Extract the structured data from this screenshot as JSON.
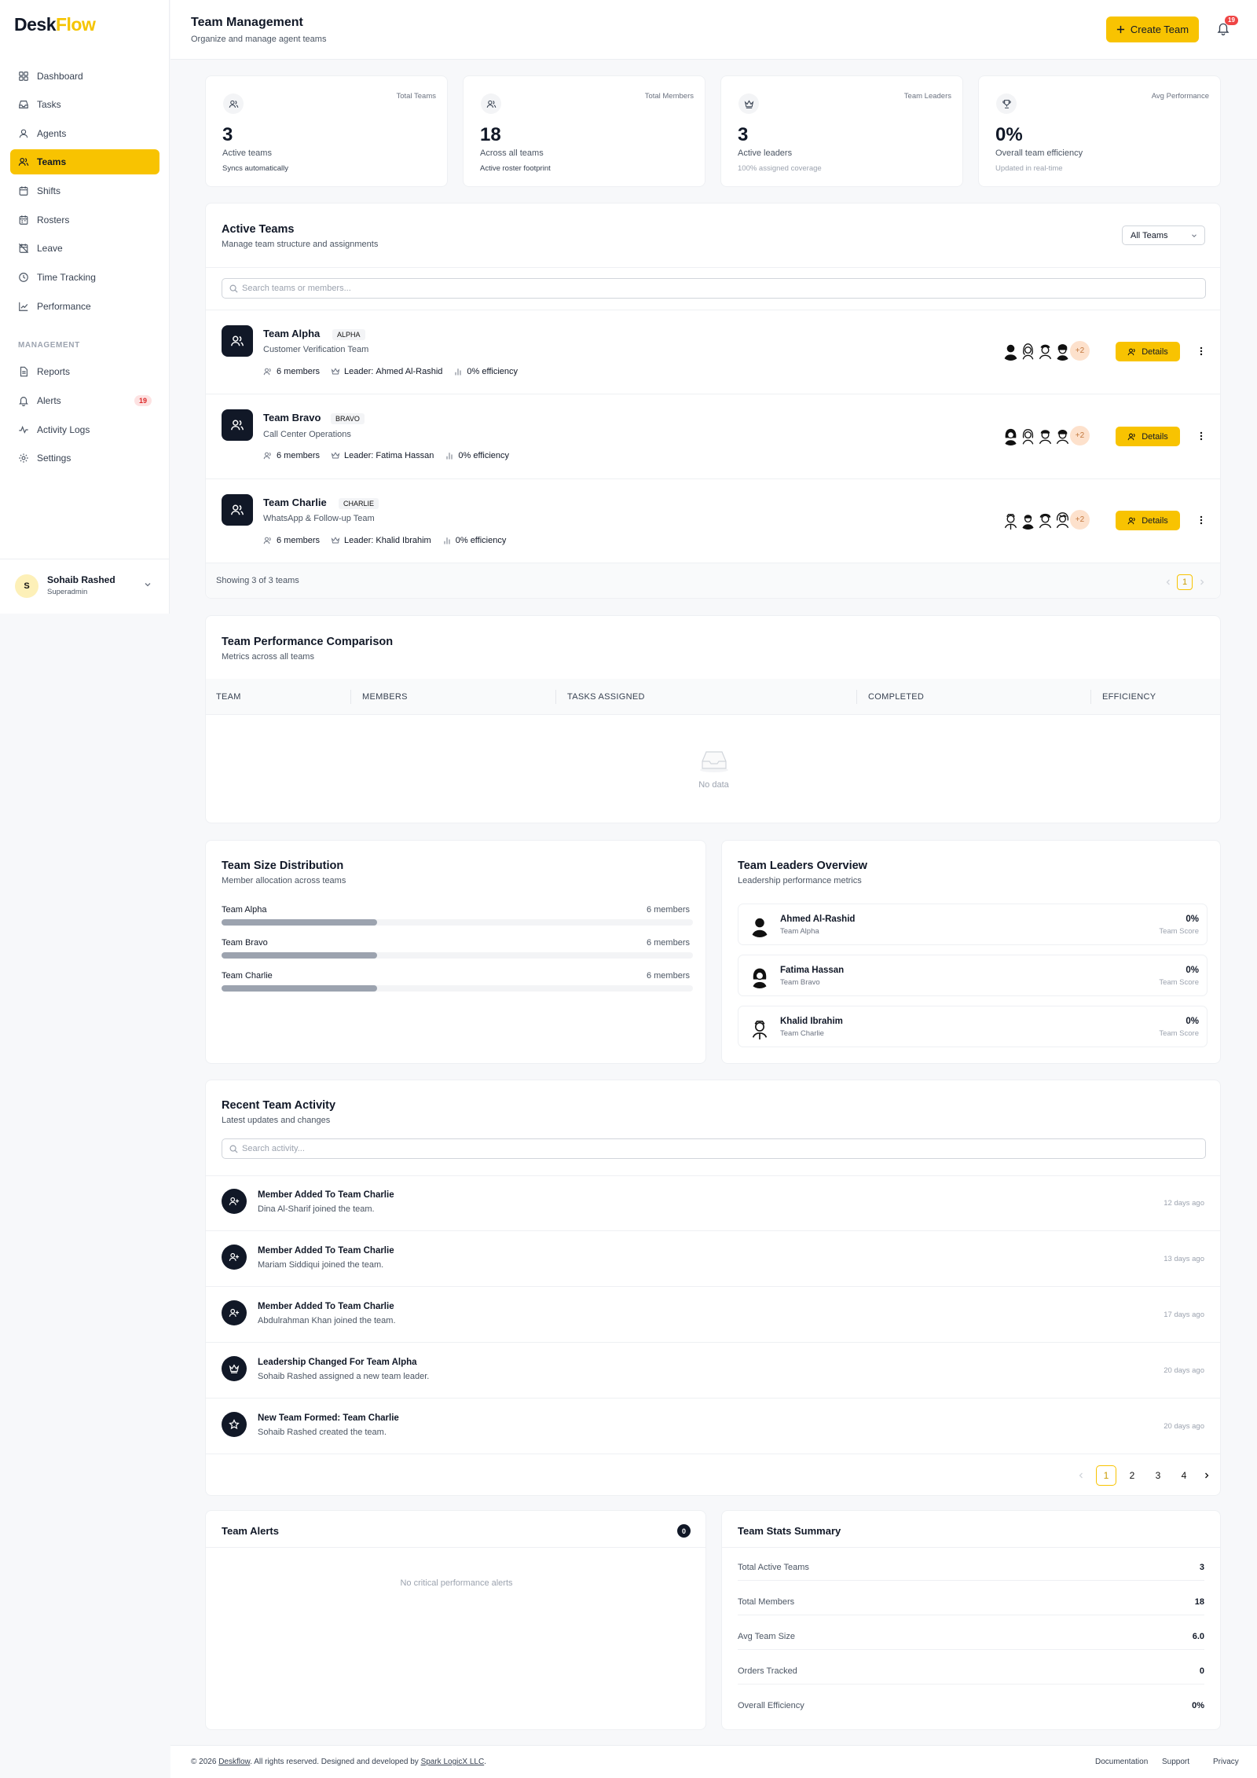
{
  "brand": {
    "part1": "Desk",
    "part2": "Flow"
  },
  "sidebar": {
    "items": [
      {
        "label": "Dashboard",
        "icon": "grid-icon"
      },
      {
        "label": "Tasks",
        "icon": "inbox-icon"
      },
      {
        "label": "Agents",
        "icon": "user-icon"
      },
      {
        "label": "Teams",
        "icon": "users-icon",
        "active": true
      },
      {
        "label": "Shifts",
        "icon": "calendar-icon"
      },
      {
        "label": "Rosters",
        "icon": "calendar-icon"
      },
      {
        "label": "Leave",
        "icon": "calendar-off-icon"
      },
      {
        "label": "Time Tracking",
        "icon": "clock-icon"
      },
      {
        "label": "Performance",
        "icon": "line-chart-icon"
      }
    ],
    "section_label": "MANAGEMENT",
    "mgmt_items": [
      {
        "label": "Reports",
        "icon": "file-icon"
      },
      {
        "label": "Alerts",
        "icon": "bell-icon",
        "badge": "19"
      },
      {
        "label": "Activity Logs",
        "icon": "activity-icon"
      },
      {
        "label": "Settings",
        "icon": "gear-icon"
      }
    ],
    "user": {
      "initial": "S",
      "name": "Sohaib Rashed",
      "role": "Superadmin"
    }
  },
  "header": {
    "title": "Team Management",
    "subtitle": "Organize and manage agent teams",
    "create_label": "Create Team",
    "notif_count": "19"
  },
  "stats": [
    {
      "label": "Total Teams",
      "value": "3",
      "sub": "Active teams",
      "note": "Syncs automatically",
      "icon": "users-icon"
    },
    {
      "label": "Total Members",
      "value": "18",
      "sub": "Across all teams",
      "note": "Active roster footprint",
      "icon": "users-icon"
    },
    {
      "label": "Team Leaders",
      "value": "3",
      "sub": "Active leaders",
      "note": "100% assigned coverage",
      "icon": "crown-icon"
    },
    {
      "label": "Avg Performance",
      "value": "0%",
      "sub": "Overall team efficiency",
      "note": "Updated in real-time",
      "icon": "trophy-icon"
    }
  ],
  "active_teams": {
    "title": "Active Teams",
    "subtitle": "Manage team structure and assignments",
    "filter": "All Teams",
    "search_placeholder": "Search teams or members...",
    "details_label": "Details",
    "more_label": "+2",
    "leader_prefix": "Leader:",
    "teams": [
      {
        "name": "Team Alpha",
        "code": "ALPHA",
        "desc": "Customer Verification Team",
        "members": "6 members",
        "leader": "Ahmed Al-Rashid",
        "efficiency": "0% efficiency"
      },
      {
        "name": "Team Bravo",
        "code": "BRAVO",
        "desc": "Call Center Operations",
        "members": "6 members",
        "leader": "Fatima Hassan",
        "efficiency": "0% efficiency"
      },
      {
        "name": "Team Charlie",
        "code": "CHARLIE",
        "desc": "WhatsApp & Follow-up Team",
        "members": "6 members",
        "leader": "Khalid Ibrahim",
        "efficiency": "0% efficiency"
      }
    ],
    "showing": "Showing 3 of 3 teams",
    "page": "1"
  },
  "comparison": {
    "title": "Team Performance Comparison",
    "subtitle": "Metrics across all teams",
    "columns": [
      "TEAM",
      "MEMBERS",
      "TASKS ASSIGNED",
      "COMPLETED",
      "EFFICIENCY"
    ],
    "empty": "No data"
  },
  "size_dist": {
    "title": "Team Size Distribution",
    "subtitle": "Member allocation across teams",
    "rows": [
      {
        "team": "Team Alpha",
        "value": "6 members",
        "share": 0.33
      },
      {
        "team": "Team Bravo",
        "value": "6 members",
        "share": 0.33
      },
      {
        "team": "Team Charlie",
        "value": "6 members",
        "share": 0.33
      }
    ]
  },
  "leaders": {
    "title": "Team Leaders Overview",
    "subtitle": "Leadership performance metrics",
    "score_label": "Team Score",
    "rows": [
      {
        "name": "Ahmed Al-Rashid",
        "team": "Team Alpha",
        "score": "0%"
      },
      {
        "name": "Fatima Hassan",
        "team": "Team Bravo",
        "score": "0%"
      },
      {
        "name": "Khalid Ibrahim",
        "team": "Team Charlie",
        "score": "0%"
      }
    ]
  },
  "activity": {
    "title": "Recent Team Activity",
    "subtitle": "Latest updates and changes",
    "search_placeholder": "Search activity...",
    "items": [
      {
        "title": "Member Added To Team Charlie",
        "desc": "Dina Al-Sharif joined the team.",
        "time": "12 days ago",
        "icon": "user-plus-icon"
      },
      {
        "title": "Member Added To Team Charlie",
        "desc": "Mariam Siddiqui joined the team.",
        "time": "13 days ago",
        "icon": "user-plus-icon"
      },
      {
        "title": "Member Added To Team Charlie",
        "desc": "Abdulrahman Khan joined the team.",
        "time": "17 days ago",
        "icon": "user-plus-icon"
      },
      {
        "title": "Leadership Changed For Team Alpha",
        "desc": "Sohaib Rashed assigned a new team leader.",
        "time": "20 days ago",
        "icon": "crown-icon"
      },
      {
        "title": "New Team Formed: Team Charlie",
        "desc": "Sohaib Rashed created the team.",
        "time": "20 days ago",
        "icon": "star-icon"
      }
    ],
    "pages": [
      "1",
      "2",
      "3",
      "4"
    ]
  },
  "alerts": {
    "title": "Team Alerts",
    "count": "0",
    "empty": "No critical performance alerts"
  },
  "summary": {
    "title": "Team Stats Summary",
    "rows": [
      {
        "label": "Total Active Teams",
        "value": "3"
      },
      {
        "label": "Total Members",
        "value": "18"
      },
      {
        "label": "Avg Team Size",
        "value": "6.0"
      },
      {
        "label": "Orders Tracked",
        "value": "0"
      },
      {
        "label": "Overall Efficiency",
        "value": "0%"
      }
    ]
  },
  "footer": {
    "copy_prefix": "© 2026",
    "brand": "Deskflow",
    "copy_mid": ". All rights reserved. Designed and developed by",
    "dev": "Spark LogicX LLC",
    "copy_end": ".",
    "links": [
      "Documentation",
      "Support",
      "Privacy"
    ]
  },
  "colors": {
    "accent": "#f8c301",
    "dark": "#111827",
    "danger": "#ef4444"
  }
}
